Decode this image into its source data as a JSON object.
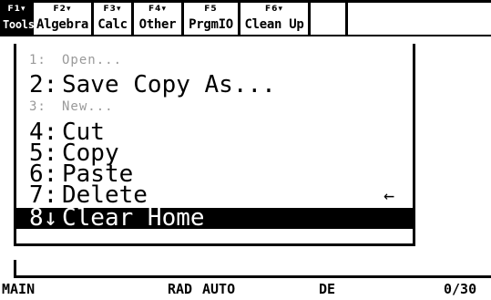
{
  "toolbar": {
    "tabs": [
      {
        "fkey": "F1▾",
        "label": "Tools"
      },
      {
        "fkey": "F2▾",
        "label": "Algebra"
      },
      {
        "fkey": "F3▾",
        "label": "Calc"
      },
      {
        "fkey": "F4▾",
        "label": "Other"
      },
      {
        "fkey": "F5",
        "label": "PrgmIO"
      },
      {
        "fkey": "F6▾",
        "label": "Clean Up"
      }
    ]
  },
  "menu": {
    "items": [
      {
        "number": "1:",
        "label": "Open...",
        "enabled": false
      },
      {
        "number": "2:",
        "label": "Save Copy As...",
        "enabled": true
      },
      {
        "number": "3:",
        "label": "New...",
        "enabled": false
      },
      {
        "number": "4:",
        "label": "Cut",
        "enabled": true
      },
      {
        "number": "5:",
        "label": "Copy",
        "enabled": true
      },
      {
        "number": "6:",
        "label": "Paste",
        "enabled": true
      },
      {
        "number": "7:",
        "label": "Delete",
        "enabled": true,
        "shortcut": "←"
      },
      {
        "number": "8↓",
        "label": "Clear Home",
        "enabled": true,
        "selected": true
      }
    ]
  },
  "entry_line": {
    "value": ""
  },
  "status_bar": {
    "folder": "MAIN",
    "angle_mode": "RAD",
    "exact_approx": "AUTO",
    "graph_mode": "DE",
    "history_count": "0/30"
  }
}
